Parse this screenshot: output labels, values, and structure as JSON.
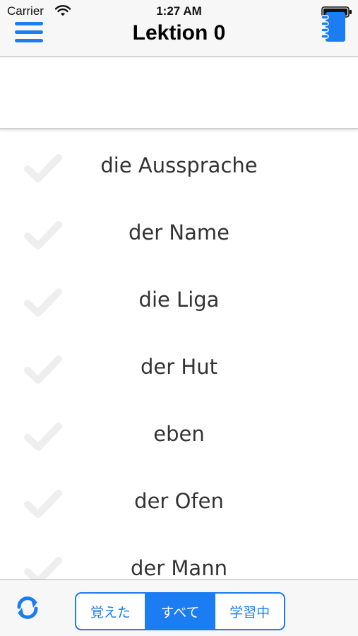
{
  "status_bar": {
    "carrier": "Carrier",
    "time": "1:27 AM",
    "wifi_icon": "wifi-icon",
    "battery_icon": "battery-icon"
  },
  "nav": {
    "title": "Lektion 0",
    "left_icon": "menu-icon",
    "right_icon": "notebook-icon"
  },
  "words": [
    {
      "text": "die Aussprache",
      "learned": false
    },
    {
      "text": "der Name",
      "learned": false
    },
    {
      "text": "die Liga",
      "learned": false
    },
    {
      "text": "der Hut",
      "learned": false
    },
    {
      "text": "eben",
      "learned": false
    },
    {
      "text": "der Ofen",
      "learned": false
    },
    {
      "text": "der Mann",
      "learned": false
    }
  ],
  "toolbar": {
    "refresh_icon": "refresh-icon",
    "segments": [
      {
        "label": "覚えた",
        "selected": false
      },
      {
        "label": "すべて",
        "selected": true
      },
      {
        "label": "学習中",
        "selected": false
      }
    ]
  },
  "colors": {
    "accent": "#1c7cf2",
    "checkmark_inactive": "#eeeeee",
    "word_text": "#333333",
    "bar_background": "#f7f7f7"
  }
}
